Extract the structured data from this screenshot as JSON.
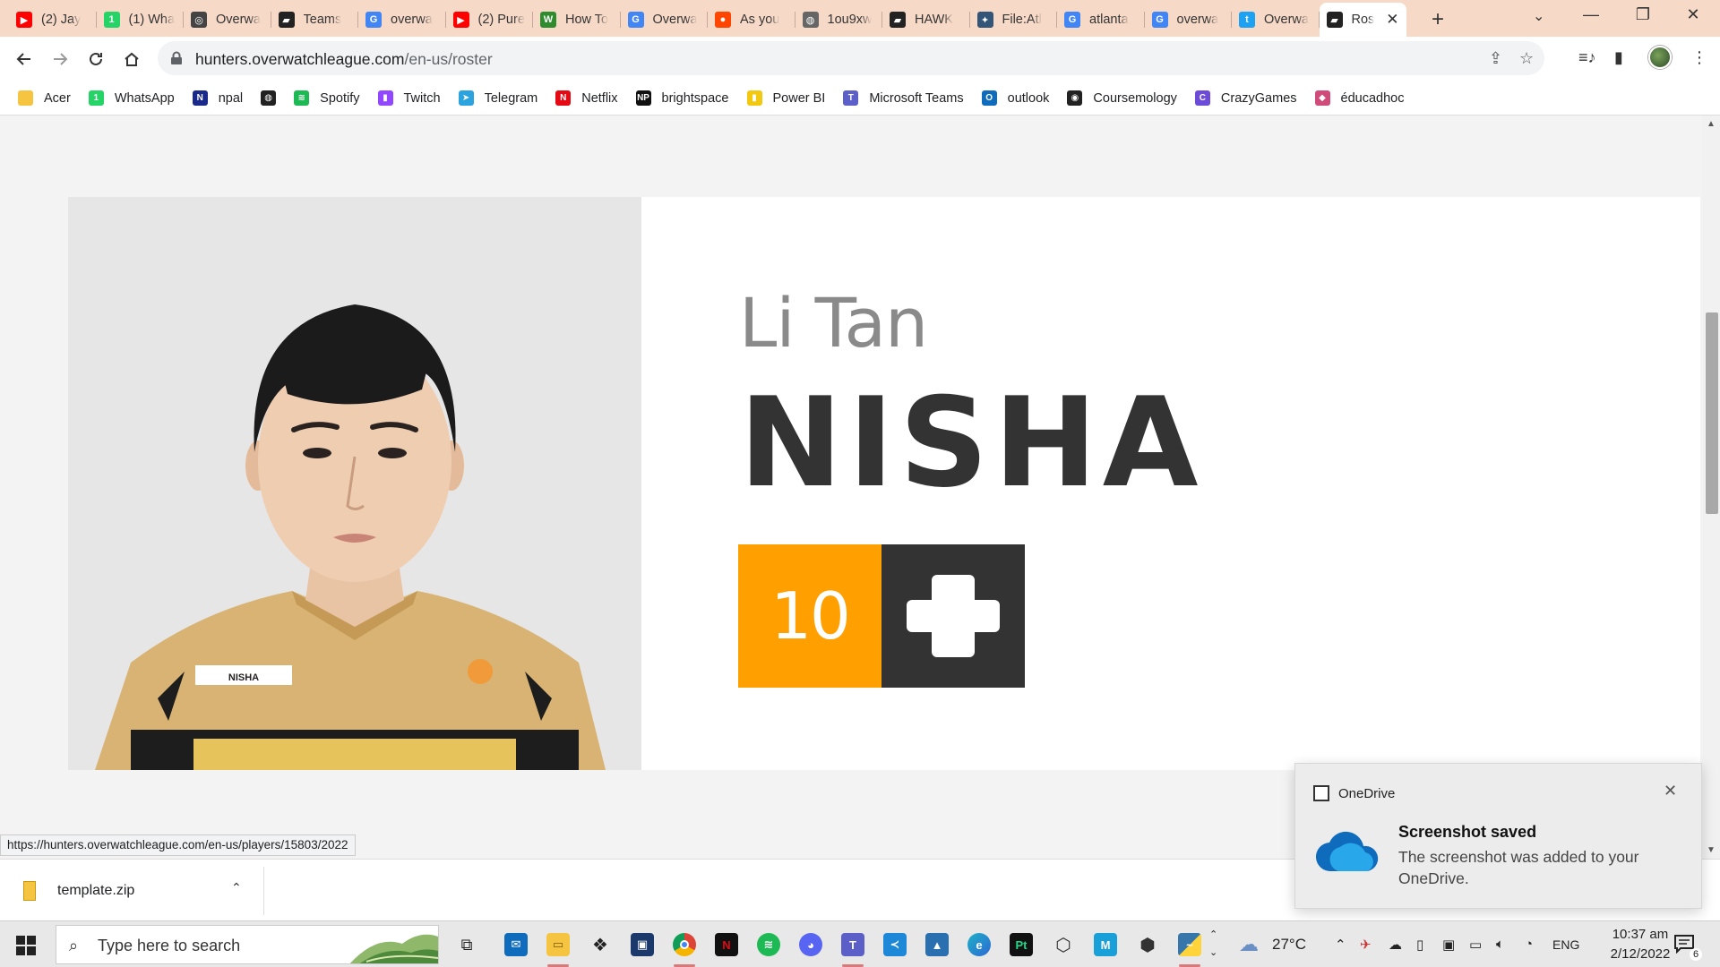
{
  "browser": {
    "tabs": [
      {
        "title": "(2) Jay",
        "icon": "youtube-icon",
        "color": "#ff0000",
        "glyph": "▶"
      },
      {
        "title": "(1) Wha",
        "icon": "whatsapp-icon",
        "color": "#25d366",
        "glyph": "1"
      },
      {
        "title": "Overwa",
        "icon": "overwatch-icon",
        "color": "#444444",
        "glyph": "◎"
      },
      {
        "title": "Teams",
        "icon": "teams-flag-icon",
        "color": "#222222",
        "glyph": "▰"
      },
      {
        "title": "overwa",
        "icon": "google-icon",
        "color": "#4285f4",
        "glyph": "G"
      },
      {
        "title": "(2) Pure",
        "icon": "youtube-icon",
        "color": "#ff0000",
        "glyph": "▶"
      },
      {
        "title": "How To",
        "icon": "wikihow-icon",
        "color": "#2e8b2e",
        "glyph": "W"
      },
      {
        "title": "Overwa",
        "icon": "google-icon",
        "color": "#4285f4",
        "glyph": "G"
      },
      {
        "title": "As you",
        "icon": "reddit-icon",
        "color": "#ff4500",
        "glyph": "●"
      },
      {
        "title": "1ou9xw",
        "icon": "globe-icon",
        "color": "#666666",
        "glyph": "◍"
      },
      {
        "title": "HAWK",
        "icon": "hawk-flag-icon",
        "color": "#222222",
        "glyph": "▰"
      },
      {
        "title": "File:Atl",
        "icon": "wiki-file-icon",
        "color": "#335577",
        "glyph": "✦"
      },
      {
        "title": "atlanta",
        "icon": "google-icon",
        "color": "#4285f4",
        "glyph": "G"
      },
      {
        "title": "overwa",
        "icon": "google-icon",
        "color": "#4285f4",
        "glyph": "G"
      },
      {
        "title": "Overwa",
        "icon": "twitter-icon",
        "color": "#1da1f2",
        "glyph": "t"
      },
      {
        "title": "Ros",
        "icon": "owl-flag-icon",
        "color": "#222222",
        "glyph": "▰",
        "active": true
      }
    ],
    "url_host": "hunters.overwatchleague.com",
    "url_path": "/en-us/roster",
    "bookmarks": [
      {
        "label": "Acer",
        "icon": "folder-icon",
        "color": "#f5c542",
        "glyph": ""
      },
      {
        "label": "WhatsApp",
        "icon": "whatsapp-icon",
        "color": "#25d366",
        "glyph": "1"
      },
      {
        "label": "npal",
        "icon": "npal-icon",
        "color": "#1a2a8a",
        "glyph": "N"
      },
      {
        "label": "",
        "icon": "globe-icon",
        "color": "#222222",
        "glyph": "◍"
      },
      {
        "label": "Spotify",
        "icon": "spotify-icon",
        "color": "#1db954",
        "glyph": "≋"
      },
      {
        "label": "Twitch",
        "icon": "twitch-icon",
        "color": "#9146ff",
        "glyph": "▮"
      },
      {
        "label": "Telegram",
        "icon": "telegram-icon",
        "color": "#2aa3df",
        "glyph": "➤"
      },
      {
        "label": "Netflix",
        "icon": "netflix-icon",
        "color": "#e50914",
        "glyph": "N"
      },
      {
        "label": "brightspace",
        "icon": "np-icon",
        "color": "#111111",
        "glyph": "NP"
      },
      {
        "label": "Power BI",
        "icon": "powerbi-icon",
        "color": "#f2c811",
        "glyph": "▮"
      },
      {
        "label": "Microsoft Teams",
        "icon": "teams-icon",
        "color": "#5b5fc7",
        "glyph": "T"
      },
      {
        "label": "outlook",
        "icon": "outlook-icon",
        "color": "#0f6cbd",
        "glyph": "O"
      },
      {
        "label": "Coursemology",
        "icon": "coursemology-icon",
        "color": "#222222",
        "glyph": "◉"
      },
      {
        "label": "CrazyGames",
        "icon": "crazygames-icon",
        "color": "#6c4bd8",
        "glyph": "C"
      },
      {
        "label": "éducadhoc",
        "icon": "educadhoc-icon",
        "color": "#d14b7a",
        "glyph": "◆"
      }
    ]
  },
  "player": {
    "first_name": "Li Tan",
    "last_name": "NISHA",
    "number": "10",
    "jersey_name": "NISHA",
    "number_color": "#ffa000",
    "role_color": "#333333",
    "role_icon": "support-cross-icon"
  },
  "status_url": "https://hunters.overwatchleague.com/en-us/players/15803/2022",
  "download": {
    "filename": "template.zip"
  },
  "toast": {
    "app": "OneDrive",
    "title": "Screenshot saved",
    "body": "The screenshot was added to your OneDrive."
  },
  "taskbar": {
    "search_placeholder": "Type here to search",
    "temperature": "27°C",
    "language": "ENG",
    "time": "10:37 am",
    "date": "2/12/2022",
    "notification_count": "6"
  }
}
